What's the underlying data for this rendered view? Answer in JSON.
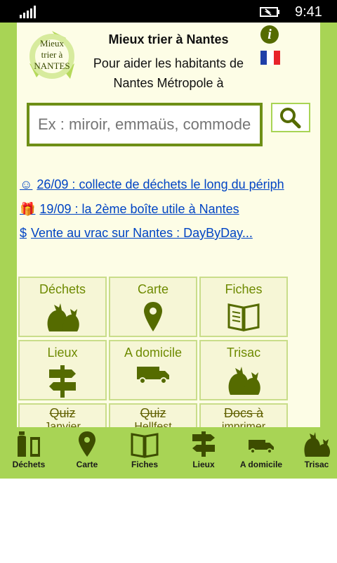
{
  "status_bar": {
    "time": "9:41"
  },
  "header": {
    "logo_text_lines": [
      "Mieux",
      "trier à",
      "NANTES"
    ],
    "title": "Mieux trier à Nantes",
    "subtitle": "Pour aider les habitants de Nantes Métropole à"
  },
  "search": {
    "placeholder": "Ex : miroir, emmaüs, commode..."
  },
  "news": [
    {
      "icon": "☺",
      "text": "26/09 : collecte de déchets le long du périph"
    },
    {
      "icon": "🎁",
      "text": "19/09 : la 2ème boîte utile à Nantes"
    },
    {
      "icon": "$",
      "text": "Vente au vrac sur Nantes : DayByDay..."
    }
  ],
  "tiles": [
    {
      "label": "Déchets",
      "icon": "trash-bags-icon"
    },
    {
      "label": "Carte",
      "icon": "map-pin-icon"
    },
    {
      "label": "Fiches",
      "icon": "book-icon"
    },
    {
      "label": "Lieux",
      "icon": "signpost-icon"
    },
    {
      "label": "A domicile",
      "icon": "truck-icon"
    },
    {
      "label": "Trisac",
      "icon": "trash-bags-icon"
    },
    {
      "label": "Quiz",
      "sub": "Janvier",
      "icon": ""
    },
    {
      "label": "Quiz",
      "sub": "Hellfest",
      "icon": ""
    },
    {
      "label": "Docs à",
      "sub": "imprimer",
      "icon": ""
    }
  ],
  "appbar": [
    {
      "label": "Déchets",
      "icon": "bottles-icon"
    },
    {
      "label": "Carte",
      "icon": "map-pin-icon"
    },
    {
      "label": "Fiches",
      "icon": "book-icon"
    },
    {
      "label": "Lieux",
      "icon": "signpost-icon"
    },
    {
      "label": "A domicile",
      "icon": "truck-icon"
    },
    {
      "label": "Trisac",
      "icon": "trash-bags-icon"
    }
  ],
  "colors": {
    "accent": "#a8d455",
    "dark_green": "#556b00",
    "link": "#0044c4",
    "panel": "#fdfde6"
  }
}
